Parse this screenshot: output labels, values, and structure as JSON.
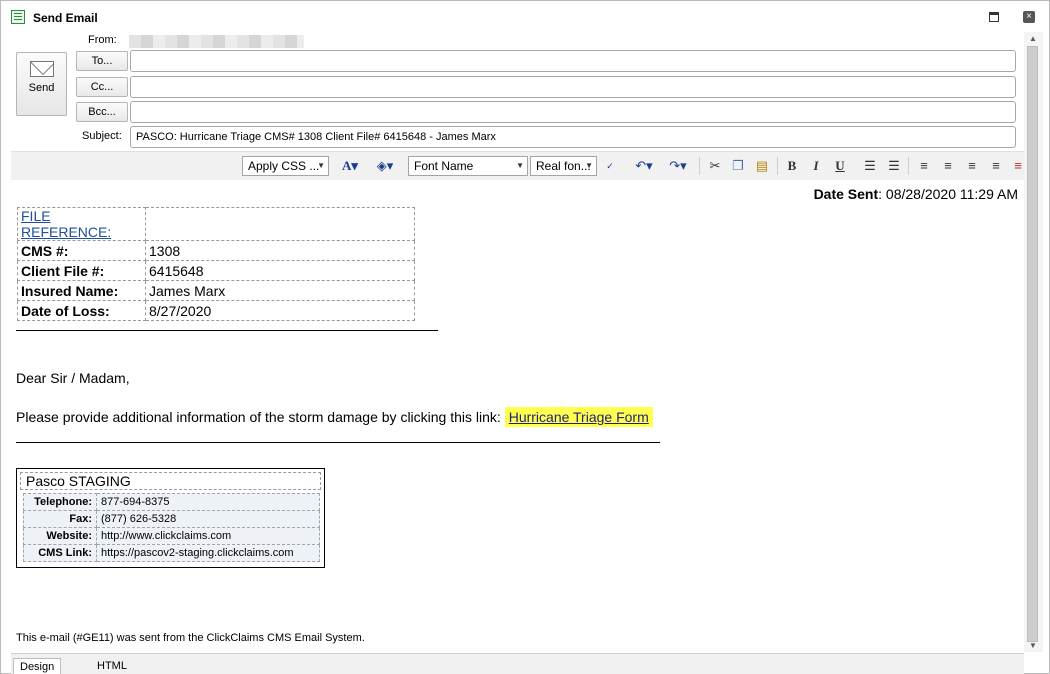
{
  "window": {
    "title": "Send Email"
  },
  "header": {
    "send_label": "Send",
    "from_label": "From:",
    "to_button": "To...",
    "cc_button": "Cc...",
    "bcc_button": "Bcc...",
    "subject_label": "Subject:",
    "subject_value": "PASCO: Hurricane Triage CMS# 1308 Client File# 6415648 - James Marx"
  },
  "toolbar": {
    "apply_css": "Apply CSS ...",
    "font_name": "Font Name",
    "font_size": "Real fon..."
  },
  "body": {
    "date_sent_label": "Date Sent",
    "date_sent_value": ": 08/28/2020 11:29 AM",
    "file_reference_title": "FILE REFERENCE:",
    "reference_rows": [
      {
        "label": "CMS #:",
        "value": "1308"
      },
      {
        "label": "Client File #:",
        "value": "6415648"
      },
      {
        "label": "Insured Name:",
        "value": "James Marx"
      },
      {
        "label": "Date of Loss:",
        "value": "8/27/2020"
      }
    ],
    "salutation": "Dear Sir / Madam,",
    "message_text": "Please provide additional information of the storm damage by clicking this link: ",
    "link_text": "Hurricane Triage Form",
    "link_highlight_color": "#ffff4d",
    "signature": {
      "company": "Pasco STAGING",
      "rows": [
        {
          "label": "Telephone:",
          "value": "877-694-8375"
        },
        {
          "label": "Fax:",
          "value": "(877) 626-5328"
        },
        {
          "label": "Website:",
          "value": "http://www.clickclaims.com"
        },
        {
          "label": "CMS Link:",
          "value": "https://pascov2-staging.clickclaims.com"
        }
      ]
    },
    "footer_note": "This e-mail (#GE11) was sent from the ClickClaims CMS Email System."
  },
  "bottom_tabs": {
    "design": "Design",
    "html": "HTML"
  }
}
